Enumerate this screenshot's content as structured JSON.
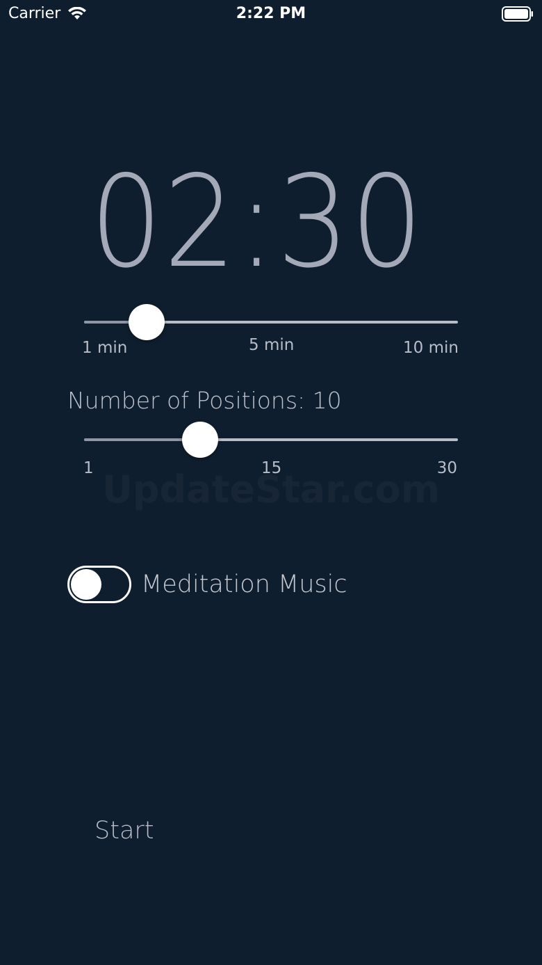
{
  "status_bar": {
    "carrier": "Carrier",
    "time": "2:22 PM",
    "icons": [
      "wifi-icon",
      "battery-icon"
    ]
  },
  "timer": {
    "display": "02:30"
  },
  "duration_slider": {
    "value_minutes": 2.5,
    "min_minutes": 1,
    "max_minutes": 10,
    "labels": {
      "min": "1 min",
      "mid": "5 min",
      "max": "10 min"
    }
  },
  "positions": {
    "heading": "Number of Positions: 10",
    "value": 10,
    "min": 1,
    "max": 30,
    "labels": {
      "min": "1",
      "mid": "15",
      "max": "30"
    }
  },
  "watermark": "UpdateStar.com",
  "music_toggle": {
    "label": "Meditation Music",
    "on": false
  },
  "start": {
    "label": "Start"
  },
  "colors": {
    "background": "#0f1e2e",
    "timer_text": "#a3a9b6",
    "muted_text": "#b8bdc7",
    "track": "#b8bcc4"
  }
}
